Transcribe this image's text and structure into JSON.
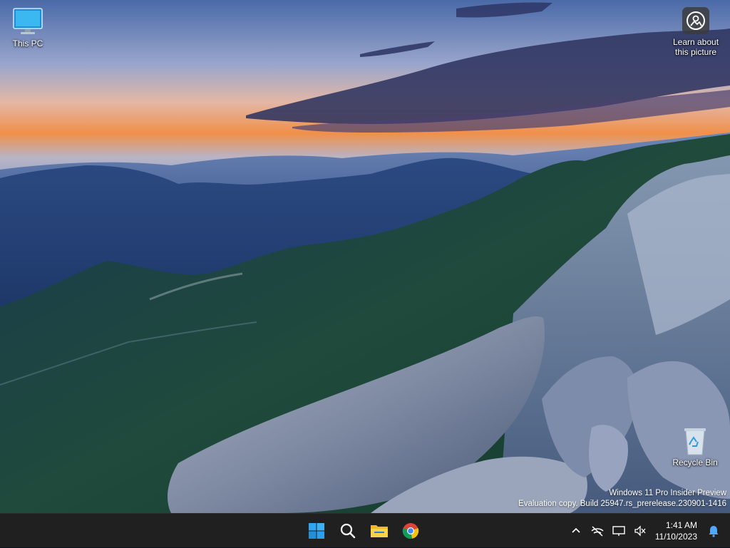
{
  "desktop": {
    "icons": [
      {
        "label": "This PC",
        "icon": "monitor-icon"
      },
      {
        "label": "Recycle Bin",
        "icon": "recycle-bin-icon"
      }
    ],
    "learn_picture": {
      "label": "Learn about this picture",
      "icon": "camera-circle-icon"
    },
    "watermark": {
      "line1": "Windows 11 Pro Insider Preview",
      "line2": "Evaluation copy. Build 25947.rs_prerelease.230901-1416"
    }
  },
  "taskbar": {
    "apps": [
      {
        "name": "Start",
        "icon": "windows-start-icon"
      },
      {
        "name": "Search",
        "icon": "search-icon"
      },
      {
        "name": "File Explorer",
        "icon": "folder-icon"
      },
      {
        "name": "Google Chrome",
        "icon": "chrome-icon"
      }
    ],
    "tray": {
      "icons": [
        "chevron-up-icon",
        "network-off-icon",
        "display-icon",
        "volume-muted-icon",
        "notification-bell-icon"
      ],
      "time": "1:41 AM",
      "date": "11/10/2023"
    }
  },
  "colors": {
    "taskbar_bg": "#202020",
    "accent": "#0078d4"
  }
}
